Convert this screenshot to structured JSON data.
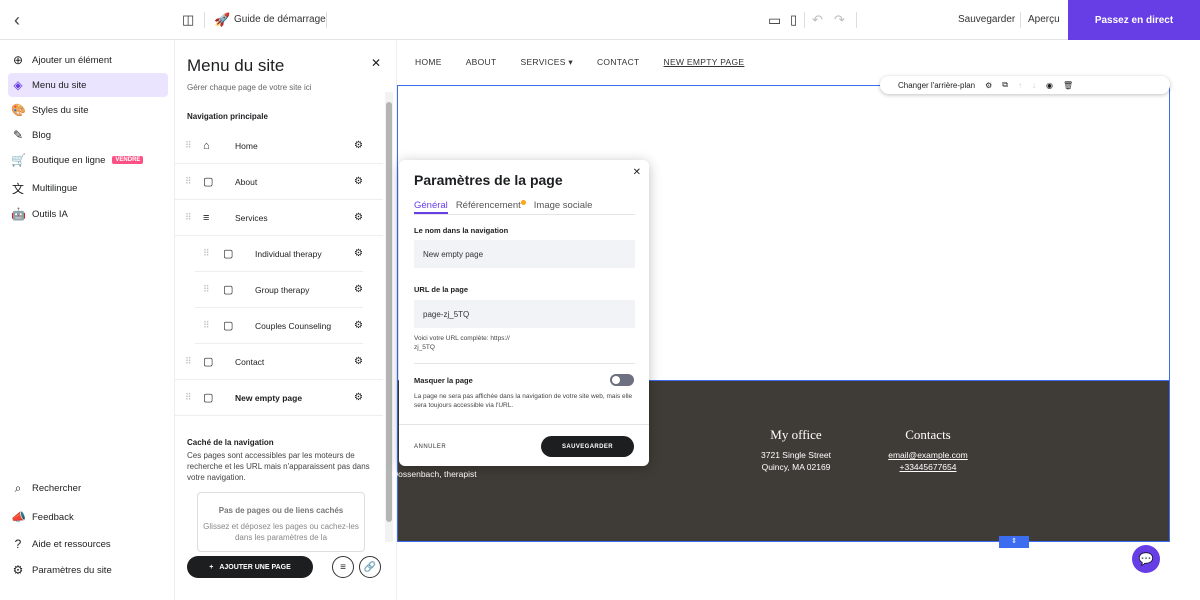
{
  "topbar": {
    "guide": "Guide de démarrage",
    "save": "Sauvegarder",
    "preview": "Aperçu",
    "live": "Passez en direct"
  },
  "sidebar": {
    "items": [
      {
        "label": "Ajouter un élément",
        "icon": "plus-circle-icon"
      },
      {
        "label": "Menu du site",
        "icon": "layers-icon"
      },
      {
        "label": "Styles du site",
        "icon": "palette-icon"
      },
      {
        "label": "Blog",
        "icon": "edit-icon"
      },
      {
        "label": "Boutique en ligne",
        "icon": "cart-icon",
        "tag": "VENDRE"
      },
      {
        "label": "Multilingue",
        "icon": "translate-icon"
      },
      {
        "label": "Outils IA",
        "icon": "robot-icon"
      }
    ],
    "bottom": [
      {
        "label": "Rechercher",
        "icon": "search-icon"
      },
      {
        "label": "Feedback",
        "icon": "megaphone-icon"
      },
      {
        "label": "Aide et ressources",
        "icon": "help-icon"
      },
      {
        "label": "Paramètres du site",
        "icon": "gear-icon"
      }
    ]
  },
  "menu": {
    "title": "Menu du site",
    "subtitle": "Gérer chaque page de votre site ici",
    "main_nav": "Navigation principale",
    "pages": [
      {
        "name": "Home"
      },
      {
        "name": "About"
      },
      {
        "name": "Services"
      },
      {
        "name": "Individual therapy"
      },
      {
        "name": "Group therapy"
      },
      {
        "name": "Couples Counseling"
      },
      {
        "name": "Contact"
      },
      {
        "name": "New empty page"
      }
    ],
    "hidden_title": "Caché de la navigation",
    "hidden_desc": "Ces pages sont accessibles par les moteurs de recherche et les URL mais n'apparaissent pas dans votre navigation.",
    "empty_title": "Pas de pages ou de liens cachés",
    "empty_desc": "Glissez et déposez les pages ou cachez-les dans les paramètres de la",
    "add_page": "AJOUTER UNE PAGE"
  },
  "canvas": {
    "nav": [
      "HOME",
      "ABOUT",
      "SERVICES",
      "CONTACT",
      "NEW EMPTY PAGE"
    ],
    "change_bg": "Changer l'arrière-plan",
    "footer": {
      "left_text": "Dossenbach, therapist",
      "office_title": "My office",
      "office_line1": "3721 Single Street",
      "office_line2": "Quincy, MA 02169",
      "contacts_title": "Contacts",
      "email": "email@example.com",
      "phone": "+33445677654"
    }
  },
  "modal": {
    "title": "Paramètres de la page",
    "tabs": [
      "Général",
      "Référencement",
      "Image sociale"
    ],
    "nav_name_label": "Le nom dans la navigation",
    "nav_name_value": "New empty page",
    "url_label": "URL de la page",
    "url_value": "page-zj_5TQ",
    "url_note": "Voici votre URL complète: https://\nzj_5TQ",
    "hide_label": "Masquer la page",
    "hide_note": "La page ne sera pas affichée dans la navigation de votre site web, mais elle sera toujours accessible via l'URL.",
    "cancel": "ANNULER",
    "save": "SAUVEGARDER"
  },
  "colors": {
    "accent": "#673de6",
    "footer": "#3f3c37",
    "select": "#3c6df0"
  }
}
